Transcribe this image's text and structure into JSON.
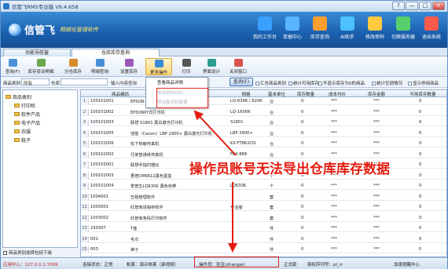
{
  "window": {
    "title": "信管飞RMS专业版 V9.4.658",
    "controls": [
      "?",
      "—",
      "□",
      "×"
    ]
  },
  "header": {
    "brand": "信管飞",
    "slogan": "精细化管理软件",
    "buttons": [
      {
        "label": "我的工作台",
        "icon": "desktop-icon",
        "color": "#3aa0ff"
      },
      {
        "label": "单据中心",
        "icon": "documents-icon",
        "color": "#58b6ff"
      },
      {
        "label": "库存查询",
        "icon": "inventory-icon",
        "color": "#ff9f2e"
      },
      {
        "label": "AI助手",
        "icon": "assistant-icon",
        "color": "#4bc1ff"
      },
      {
        "label": "修改密码",
        "icon": "lock-icon",
        "color": "#ffc940"
      },
      {
        "label": "切换服务器",
        "icon": "server-icon",
        "color": "#55d06a"
      },
      {
        "label": "退出系统",
        "icon": "exit-icon",
        "color": "#ff5a4a"
      }
    ]
  },
  "tabs": [
    {
      "label": "功能导航窗"
    },
    {
      "label": "仓库库存查询"
    }
  ],
  "toolbar": {
    "buttons": [
      {
        "label": "查询(F)",
        "icon": "search-icon",
        "color": "#4a90d9"
      },
      {
        "label": "库存变动明细",
        "icon": "list-icon",
        "color": "#6aa84f"
      },
      {
        "label": "分仓库存",
        "icon": "warehouse-icon",
        "color": "#d98b2b"
      },
      {
        "label": "明细查询",
        "icon": "detail-icon",
        "color": "#4a90d9"
      },
      {
        "label": "设置库存",
        "icon": "settings-icon",
        "color": "#9b59b6"
      },
      {
        "label": "更多操作",
        "icon": "more-icon",
        "color": "#3b8ad8"
      },
      {
        "label": "打印",
        "icon": "print-icon",
        "color": "#555555"
      },
      {
        "label": "界面设计",
        "icon": "design-icon",
        "color": "#2e9c8f"
      },
      {
        "label": "关闭窗口",
        "icon": "close-icon",
        "color": "#d9534f"
      }
    ]
  },
  "menu": {
    "items": [
      {
        "label": "查看商品详情",
        "disabled": false
      },
      {
        "label": "导出到EXCEL",
        "disabled": true
      },
      {
        "label": "导出盘点机数据",
        "disabled": true
      }
    ]
  },
  "filters": {
    "category_label": "商品类别",
    "category_value": "所有",
    "warehouse_label": "仓库",
    "keyword_placeholder": "输入内容查询",
    "query_button": "查询(F)",
    "checks": [
      {
        "label": "汇总商品类别"
      },
      {
        "label": "统计可用库存"
      },
      {
        "label": "不显示库存为0的商品"
      },
      {
        "label": "统计空调情况"
      },
      {
        "label": "显示停用商品"
      }
    ]
  },
  "tree": {
    "root": "商品类别",
    "children": [
      "打印机",
      "软件产品",
      "电子产品",
      "衣服",
      "鞋子"
    ],
    "footer_checkbox": "商品类别选择包括下级"
  },
  "grid": {
    "columns": [
      "商品编码",
      "规格",
      "基本单位",
      "库存数量",
      "成本均价",
      "库存金额",
      "可用库存数量"
    ],
    "rows": [
      {
        "n": "1",
        "code": "100101001",
        "name": "EPSON LQ-630K（单层）",
        "spec": "LQ-630K | 620K",
        "unit": "台",
        "qty": "0",
        "cost": "***",
        "amount": "***",
        "avail": "0"
      },
      {
        "n": "2",
        "code": "100101002",
        "name": "EPSON针式打印机",
        "spec": "LQ-1600K",
        "unit": "台",
        "qty": "0",
        "cost": "***",
        "amount": "***",
        "avail": "0"
      },
      {
        "n": "3",
        "code": "100101003",
        "name": "联想 S1801 黑白激光打印机",
        "spec": "S1801",
        "unit": "台",
        "qty": "0",
        "cost": "***",
        "amount": "***",
        "avail": "0"
      },
      {
        "n": "4",
        "code": "100101005",
        "name": "佳能（Canon）LBP 2900+ 黑白激光打印机",
        "spec": "LBP 2900+",
        "unit": "台",
        "qty": "0",
        "cost": "***",
        "amount": "***",
        "avail": "0"
      },
      {
        "n": "5",
        "code": "100101006",
        "name": "松下热敏传真机",
        "spec": "KX-FT862CN",
        "unit": "台",
        "qty": "0",
        "cost": "***",
        "amount": "***",
        "avail": "0"
      },
      {
        "n": "6",
        "code": "100102002",
        "name": "兄弟普通纸传真机",
        "spec": "FAX-888",
        "unit": "台",
        "qty": "0",
        "cost": "***",
        "amount": "***",
        "avail": "0"
      },
      {
        "n": "7",
        "code": "100102001",
        "name": "联想手指扫描仪",
        "spec": "",
        "unit": "台",
        "qty": "0",
        "cost": "***",
        "amount": "***",
        "avail": "0"
      },
      {
        "n": "8",
        "code": "100102003",
        "name": "惠普CM6612黑色墨盒",
        "spec": "",
        "unit": "个",
        "qty": "0",
        "cost": "***",
        "amount": "***",
        "avail": "0"
      },
      {
        "n": "9",
        "code": "100101004",
        "name": "爱普生LQ630K 黑色色带",
        "spec": "LQ630K",
        "unit": "个",
        "qty": "0",
        "cost": "***",
        "amount": "***",
        "avail": "0"
      },
      {
        "n": "10",
        "code": "1004001",
        "name": "丑租管理软件",
        "spec": "",
        "unit": "套",
        "qty": "0",
        "cost": "***",
        "amount": "***",
        "avail": "0"
      },
      {
        "n": "11",
        "code": "1003001",
        "name": "红管家进销存软件",
        "spec": "专业版",
        "unit": "套",
        "qty": "0",
        "cost": "***",
        "amount": "***",
        "avail": "0"
      },
      {
        "n": "12",
        "code": "1003002",
        "name": "红管家条码打印软件",
        "spec": "",
        "unit": "套",
        "qty": "0",
        "cost": "***",
        "amount": "***",
        "avail": "0"
      },
      {
        "n": "13",
        "code": "230307",
        "name": "T恤",
        "spec": "",
        "unit": "件",
        "qty": "0",
        "cost": "***",
        "amount": "***",
        "avail": "0"
      },
      {
        "n": "14",
        "code": "001",
        "name": "毛巾",
        "spec": "",
        "unit": "件",
        "qty": "0",
        "cost": "***",
        "amount": "***",
        "avail": "0"
      },
      {
        "n": "15",
        "code": "003",
        "name": "裤子",
        "spec": "",
        "unit": "件",
        "qty": "0",
        "cost": "***",
        "amount": "***",
        "avail": "0"
      }
    ]
  },
  "annotation": {
    "text": "操作员账号无法导出仓库库存数据",
    "color": "#e31d10"
  },
  "status": {
    "app_center": "应用中心：127.0.0.1:7099",
    "connection": "连接状态：正常",
    "ledger": "帐套：演示帐套（录视频）",
    "operator": "操作员：张豆(zhangw)",
    "version": "正式版",
    "license": "授权序列号：pl_rr",
    "contact": "加速提醒中心"
  }
}
